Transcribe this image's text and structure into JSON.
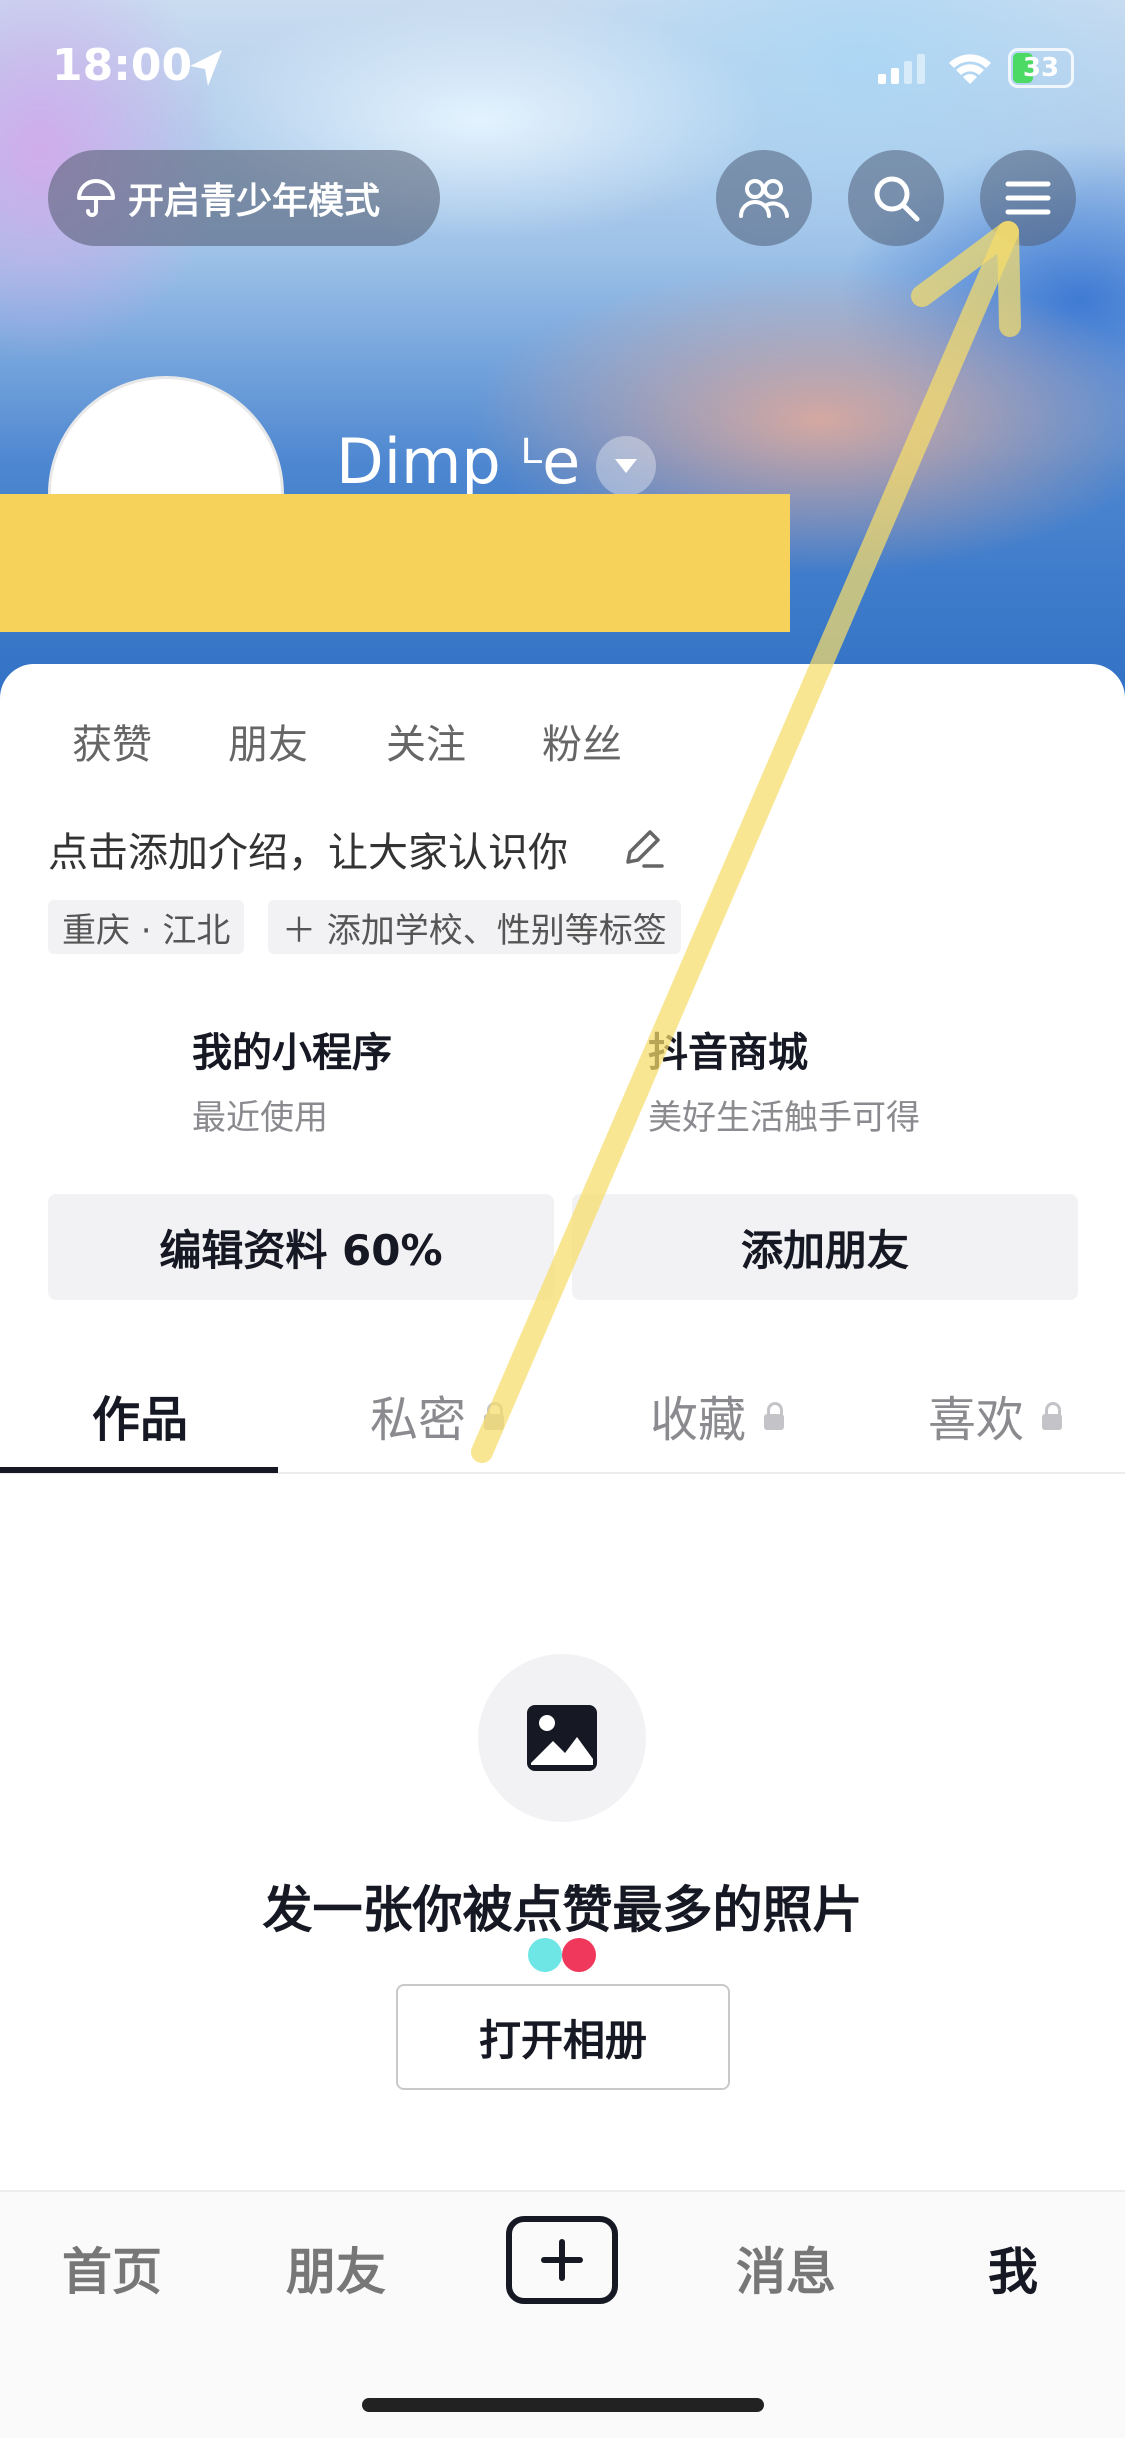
{
  "status_bar": {
    "time": "18:00",
    "battery": "33"
  },
  "header": {
    "teen_mode_label": "开启青少年模式"
  },
  "profile": {
    "username": "Dimp ᴸe",
    "stats": [
      "获赞",
      "朋友",
      "关注",
      "粉丝"
    ],
    "bio_placeholder": "点击添加介绍，让大家认识你",
    "tags": [
      "重庆 · 江北",
      "＋ 添加学校、性别等标签"
    ]
  },
  "shortcuts": [
    {
      "title": "我的小程序",
      "subtitle": "最近使用"
    },
    {
      "title": "抖音商城",
      "subtitle": "美好生活触手可得"
    }
  ],
  "actions": {
    "edit_profile": "编辑资料 60%",
    "add_friend": "添加朋友"
  },
  "tabs": [
    {
      "label": "作品",
      "active": true,
      "locked": false
    },
    {
      "label": "私密",
      "active": false,
      "locked": true
    },
    {
      "label": "收藏",
      "active": false,
      "locked": true
    },
    {
      "label": "喜欢",
      "active": false,
      "locked": true
    }
  ],
  "empty_state": {
    "title": "发一张你被点赞最多的照片",
    "button": "打开相册"
  },
  "bottom_nav": {
    "home": "首页",
    "friends": "朋友",
    "messages": "消息",
    "me": "我"
  },
  "colors": {
    "accent_cyan": "#6ee6e6",
    "accent_red": "#f0385c",
    "annotation_arrow": "#f6dc6a"
  }
}
